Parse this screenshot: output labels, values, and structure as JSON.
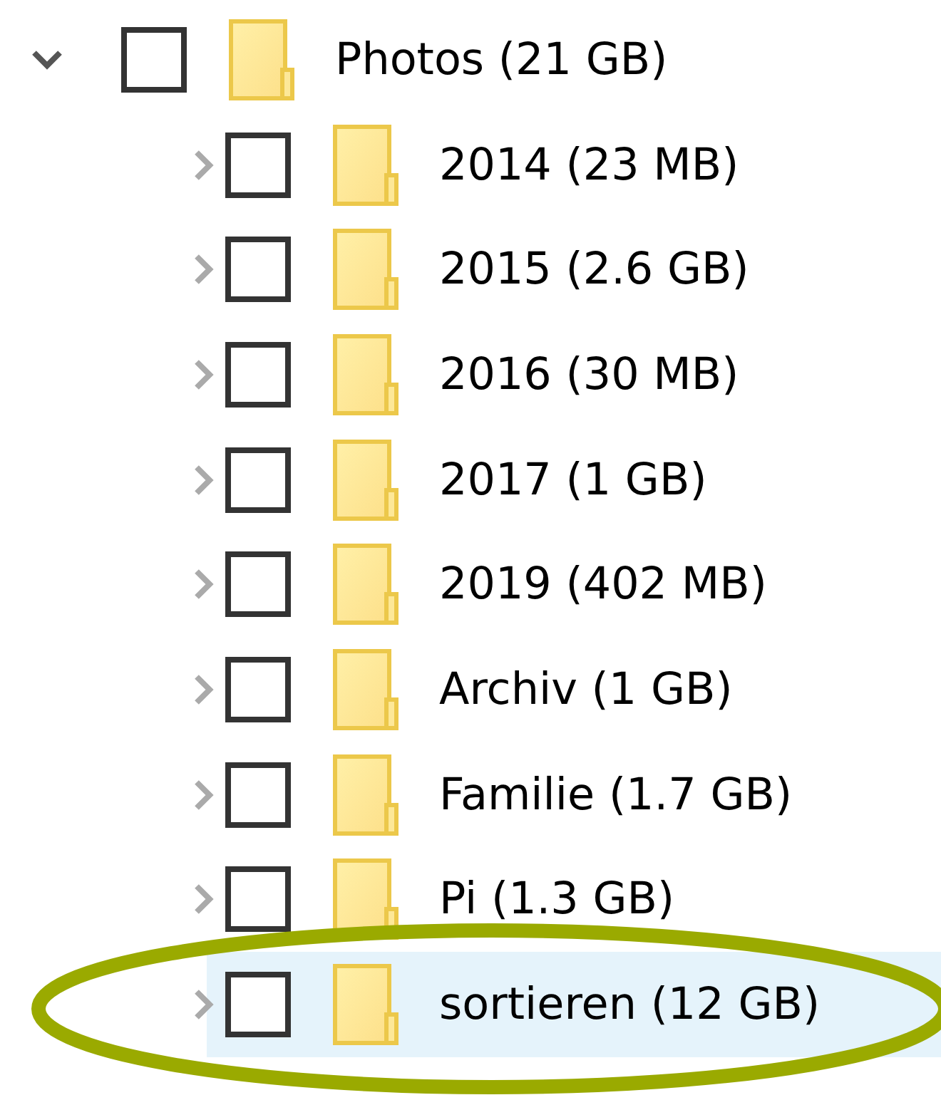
{
  "tree": [
    {
      "label": "Photos (21 GB)",
      "expanded": true,
      "checked": false,
      "selected": false,
      "children": [
        {
          "label": "2014 (23 MB)",
          "expanded": false,
          "checked": false,
          "selected": false
        },
        {
          "label": "2015 (2.6 GB)",
          "expanded": false,
          "checked": false,
          "selected": false
        },
        {
          "label": "2016 (30 MB)",
          "expanded": false,
          "checked": false,
          "selected": false
        },
        {
          "label": "2017 (1 GB)",
          "expanded": false,
          "checked": false,
          "selected": false
        },
        {
          "label": "2019 (402 MB)",
          "expanded": false,
          "checked": false,
          "selected": false
        },
        {
          "label": "Archiv (1 GB)",
          "expanded": false,
          "checked": false,
          "selected": false
        },
        {
          "label": "Familie (1.7 GB)",
          "expanded": false,
          "checked": false,
          "selected": false
        },
        {
          "label": "Pi (1.3 GB)",
          "expanded": false,
          "checked": false,
          "selected": false
        },
        {
          "label": "sortieren (12 GB)",
          "expanded": false,
          "checked": false,
          "selected": true
        }
      ]
    }
  ],
  "annotation": {
    "kind": "ellipse"
  }
}
